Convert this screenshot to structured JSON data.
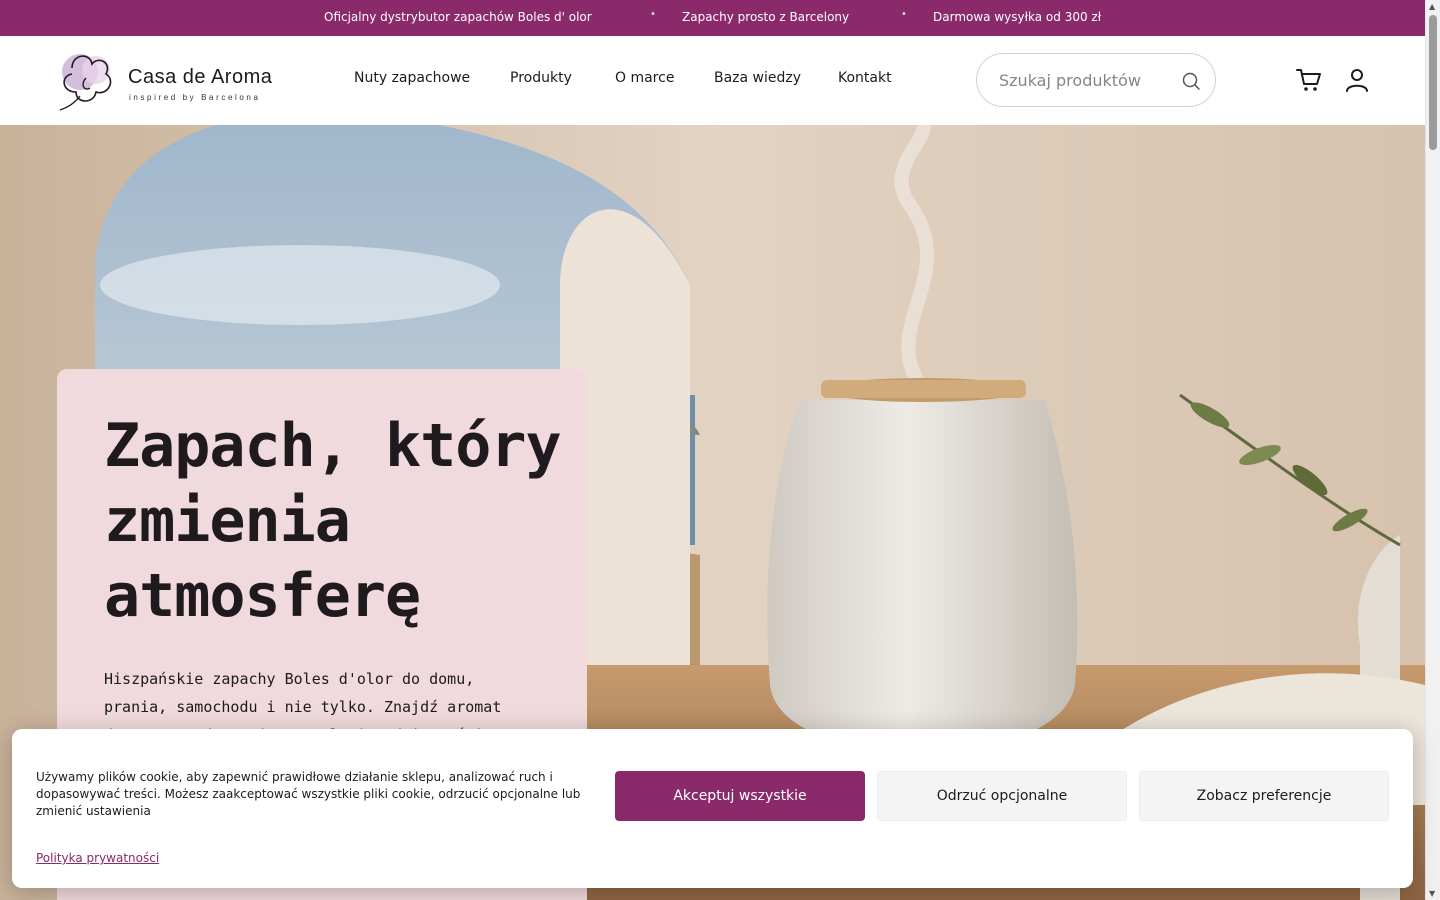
{
  "promo": {
    "items": [
      "Oficjalny dystrybutor zapachów Boles d' olor",
      "Zapachy prosto z Barcelony",
      "Darmowa wysyłka od 300 zł"
    ],
    "separator": "•"
  },
  "brand": {
    "name": "Casa de Aroma",
    "tagline": "inspired by Barcelona",
    "accent_color": "#8b2a6b"
  },
  "nav": {
    "items": [
      "Nuty zapachowe",
      "Produkty",
      "O marce",
      "Baza wiedzy",
      "Kontakt"
    ]
  },
  "search": {
    "placeholder": "Szukaj produktów",
    "icon": "search-icon"
  },
  "header_icons": [
    "cart-icon",
    "user-icon"
  ],
  "hero": {
    "title": "Zapach, który zmienia atmosferę",
    "text": "Hiszpańskie zapachy Boles d'olor do domu, prania, samochodu i nie tylko. Znajdź aromat dopasowany do swojego stylu i codzienności."
  },
  "cookie": {
    "message": "Używamy plików cookie, aby zapewnić prawidłowe działanie sklepu, analizować ruch i dopasowywać treści. Możesz zaakceptować wszystkie pliki cookie, odrzucić opcjonalne lub zmienić ustawienia",
    "policy_link": "Polityka prywatności",
    "accept_label": "Akceptuj wszystkie",
    "reject_label": "Odrzuć opcjonalne",
    "preferences_label": "Zobacz preferencje"
  }
}
